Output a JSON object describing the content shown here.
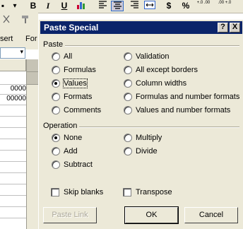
{
  "toolbar": {
    "bold_label": "B",
    "italic_label": "I",
    "underline_label": "U",
    "currency_label": "$",
    "percent_label": "%",
    "increase_decimal_label": "+.0 .00",
    "decrease_decimal_label": ".00 +.0"
  },
  "menu": {
    "insert_label": "sert",
    "format_label": "For"
  },
  "sheet": {
    "cell_values": [
      "0000",
      "00000"
    ]
  },
  "dialog": {
    "title": "Paste Special",
    "help_label": "?",
    "close_label": "X",
    "paste_group": {
      "label": "Paste",
      "left_options": [
        "All",
        "Formulas",
        "Values",
        "Formats",
        "Comments"
      ],
      "right_options": [
        "Validation",
        "All except borders",
        "Column widths",
        "Formulas and number formats",
        "Values and number formats"
      ],
      "selected": "Values"
    },
    "operation_group": {
      "label": "Operation",
      "left_options": [
        "None",
        "Add",
        "Subtract"
      ],
      "right_options": [
        "Multiply",
        "Divide"
      ],
      "selected": "None"
    },
    "skip_blanks_label": "Skip blanks",
    "transpose_label": "Transpose",
    "paste_link_label": "Paste Link",
    "ok_label": "OK",
    "cancel_label": "Cancel"
  }
}
